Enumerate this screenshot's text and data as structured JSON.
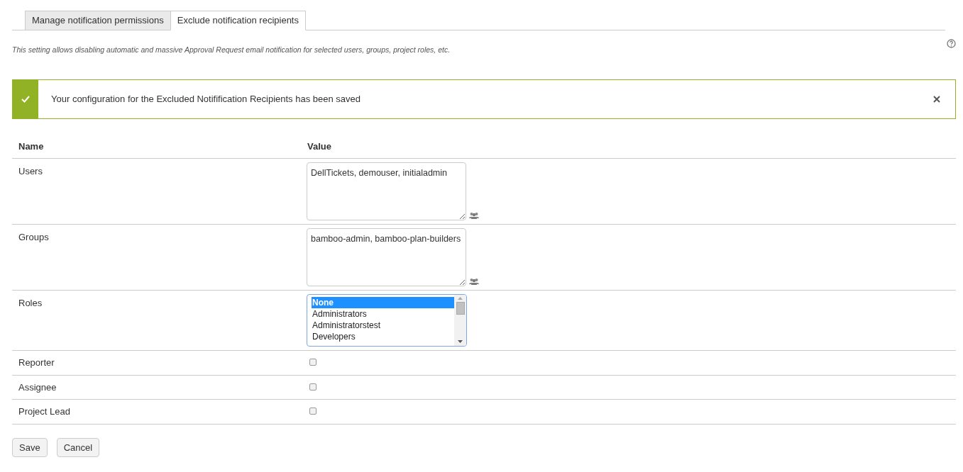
{
  "tabs": [
    {
      "label": "Manage notification permissions",
      "selected": false
    },
    {
      "label": "Exclude notification recipients",
      "selected": true
    }
  ],
  "description": "This setting allows disabling automatic and massive Approval Request email notification for selected users, groups, project roles, etc.",
  "alert": {
    "message": "Your configuration for the Excluded Notifification Recipients has been saved"
  },
  "table": {
    "columns": [
      "Name",
      "Value"
    ],
    "rows": [
      {
        "kind": "textarea",
        "name": "Users",
        "value": "DellTickets, demouser, initialadmin"
      },
      {
        "kind": "textarea",
        "name": "Groups",
        "value": "bamboo-admin, bamboo-plan-builders"
      },
      {
        "kind": "select",
        "name": "Roles",
        "options": [
          {
            "label": "None",
            "selected": true
          },
          {
            "label": "Administrators",
            "selected": false
          },
          {
            "label": "Administratorstest",
            "selected": false
          },
          {
            "label": "Developers",
            "selected": false
          }
        ]
      },
      {
        "kind": "checkbox",
        "name": "Reporter",
        "checked": false
      },
      {
        "kind": "checkbox",
        "name": "Assignee",
        "checked": false
      },
      {
        "kind": "checkbox",
        "name": "Project Lead",
        "checked": false
      }
    ]
  },
  "buttons": [
    "Save",
    "Cancel"
  ]
}
